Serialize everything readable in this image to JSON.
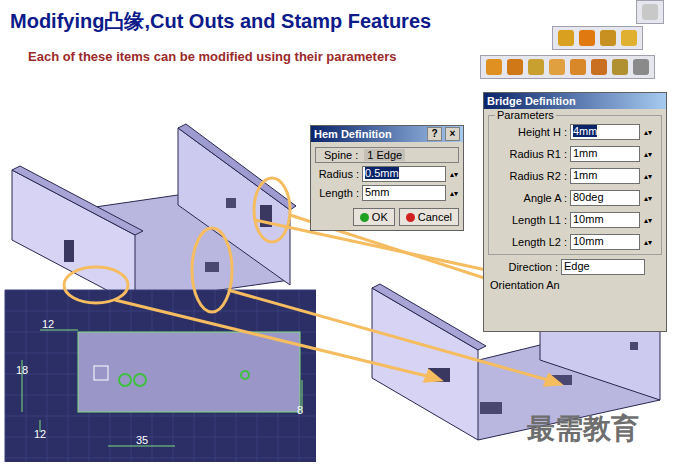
{
  "slide": {
    "title": "Modifying凸缘,Cut Outs and Stamp Features",
    "subtitle": "Each of these items can be modified using their parameters"
  },
  "hem_dialog": {
    "title": "Hem Definition",
    "title_buttons": [
      "?",
      "×"
    ],
    "fields": [
      {
        "label": "Spine :",
        "value": "1 Edge",
        "kind": "readonly",
        "selected": false
      },
      {
        "label": "Radius :",
        "value": "0.5mm",
        "kind": "spinner",
        "selected": true
      },
      {
        "label": "Length :",
        "value": "5mm",
        "kind": "spinner",
        "selected": false
      }
    ],
    "buttons": [
      {
        "label": "OK",
        "kind": "ok"
      },
      {
        "label": "Cancel",
        "kind": "cancel"
      }
    ]
  },
  "bridge_dialog": {
    "title": "Bridge Definition",
    "group": "Parameters",
    "fields": [
      {
        "label": "Height H :",
        "value": "4mm",
        "selected": true
      },
      {
        "label": "Radius R1 :",
        "value": "1mm",
        "selected": false
      },
      {
        "label": "Radius R2 :",
        "value": "1mm",
        "selected": false
      },
      {
        "label": "Angle A :",
        "value": "80deg",
        "selected": false
      },
      {
        "label": "Length L1 :",
        "value": "10mm",
        "selected": false
      },
      {
        "label": "Length L2 :",
        "value": "10mm",
        "selected": false
      }
    ],
    "direction": {
      "label": "Direction :",
      "value": "Edge"
    },
    "orientation_label": "Orientation An"
  },
  "sketch": {
    "dimensions": [
      "12",
      "18",
      "12",
      "35",
      "8"
    ]
  },
  "watermark": "最需教育"
}
